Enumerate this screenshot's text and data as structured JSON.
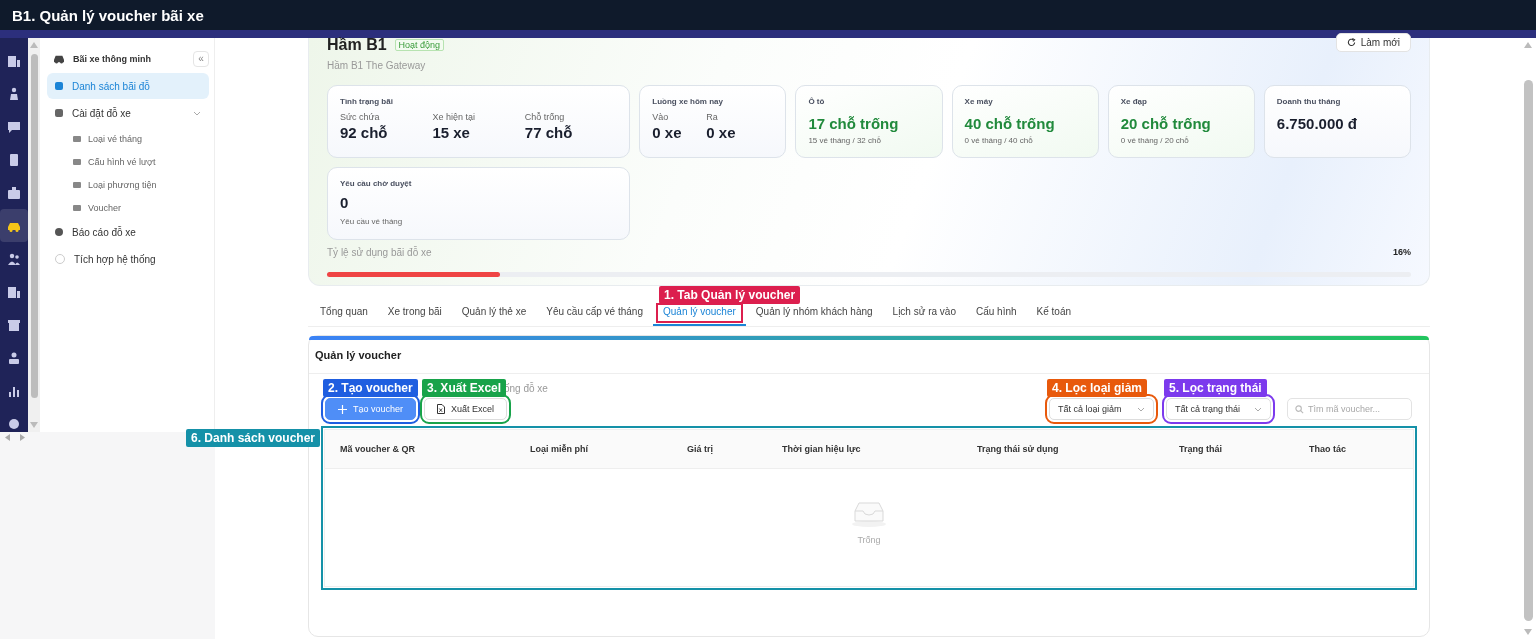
{
  "title": "B1. Quản lý voucher bãi xe",
  "rail": [
    {
      "selected": false
    },
    {
      "selected": false
    },
    {
      "selected": false
    },
    {
      "selected": false
    },
    {
      "selected": false
    },
    {
      "selected": true
    },
    {
      "selected": false
    },
    {
      "selected": false
    },
    {
      "selected": false
    },
    {
      "selected": false
    },
    {
      "selected": false
    },
    {
      "selected": false
    }
  ],
  "sidebar": {
    "heading": "Bãi xe thông minh",
    "collapse_label": "«",
    "items": [
      {
        "label": "Danh sách bãi đỗ",
        "selected": true
      },
      {
        "label": "Cài đặt đỗ xe",
        "selected": false,
        "expanded": true,
        "children": [
          {
            "label": "Loại vé tháng",
            "selected": false
          },
          {
            "label": "Cấu hình vé lượt",
            "selected": false
          },
          {
            "label": "Loại phương tiện",
            "selected": false
          },
          {
            "label": "Voucher",
            "selected": false
          }
        ]
      },
      {
        "label": "Báo cáo đỗ xe",
        "selected": false
      },
      {
        "label": "Tích hợp hệ thống",
        "selected": false
      }
    ]
  },
  "parking": {
    "name": "Hầm B1",
    "status": "Hoạt động",
    "subtitle": "Hầm B1 The Gateway",
    "refresh_label": "Làm mới",
    "cards": [
      {
        "kind": "metrics",
        "wide": true,
        "title": "Tình trạng bãi",
        "metrics": [
          {
            "label": "Sức chứa",
            "value": "92 chỗ"
          },
          {
            "label": "Xe hiện tại",
            "value": "15 xe"
          },
          {
            "label": "Chỗ trống",
            "value": "77 chỗ"
          }
        ]
      },
      {
        "kind": "metrics",
        "wide": false,
        "title": "Luồng xe hôm nay",
        "metrics": [
          {
            "label": "Vào",
            "value": "0 xe"
          },
          {
            "label": "Ra",
            "value": "0 xe"
          }
        ]
      },
      {
        "kind": "availability",
        "wide": false,
        "title": "Ô tô",
        "value": "17 chỗ trống",
        "note": "15 vé tháng / 32 chỗ"
      },
      {
        "kind": "availability",
        "wide": false,
        "title": "Xe máy",
        "value": "40 chỗ trống",
        "note": "0 vé tháng / 40 chỗ"
      },
      {
        "kind": "availability",
        "wide": false,
        "title": "Xe đạp",
        "value": "20 chỗ trống",
        "note": "0 vé tháng / 20 chỗ"
      },
      {
        "kind": "single",
        "wide": false,
        "title": "Doanh thu tháng",
        "value": "6.750.000 đ"
      },
      {
        "kind": "single",
        "wide": true,
        "title": "Yêu cầu chờ duyệt",
        "value": "0",
        "note": "Yêu cầu vé tháng"
      }
    ],
    "usage": {
      "label": "Tỷ lệ sử dụng bãi đỗ xe",
      "reading": "16%",
      "level": 0.16
    }
  },
  "tabs": [
    {
      "label": "Tổng quan",
      "selected": false
    },
    {
      "label": "Xe trong bãi",
      "selected": false
    },
    {
      "label": "Quản lý thẻ xe",
      "selected": false
    },
    {
      "label": "Yêu cầu cấp vé tháng",
      "selected": false
    },
    {
      "label": "Quản lý voucher",
      "selected": true,
      "annotation": {
        "label": "1. Tab Quản lý voucher",
        "color": "#dc1f4e"
      }
    },
    {
      "label": "Quản lý nhóm khách hàng",
      "selected": false
    },
    {
      "label": "Lịch sử ra vào",
      "selected": false
    },
    {
      "label": "Cấu hình",
      "selected": false
    },
    {
      "label": "Kế toán",
      "selected": false
    }
  ],
  "voucher_panel": {
    "title": "Quản lý voucher",
    "subtitle": "ống đỗ xe",
    "create_button": {
      "label": "Tạo voucher",
      "annotation": {
        "label": "2. Tạo voucher",
        "color": "#1f5ee0"
      }
    },
    "export_button": {
      "label": "Xuất Excel",
      "annotation": {
        "label": "3. Xuất Excel",
        "color": "#18a34a"
      }
    },
    "filters": [
      {
        "value": "Tất cả loại giảm",
        "annotation": {
          "label": "4. Lọc loại giảm",
          "color": "#e8590c"
        }
      },
      {
        "value": "Tất cả trạng thái",
        "annotation": {
          "label": "5. Lọc trạng thái",
          "color": "#7c3aed"
        }
      }
    ],
    "search": {
      "placeholder": "Tìm mã voucher..."
    },
    "table": {
      "columns": [
        "Mã voucher & QR",
        "Loại miễn phí",
        "Giá trị",
        "Thời gian hiệu lực",
        "Trạng thái sử dụng",
        "Trạng thái",
        "Thao tác"
      ],
      "empty_text": "Trống",
      "annotation": {
        "label": "6. Danh sách voucher",
        "color": "#1591a8"
      }
    }
  }
}
